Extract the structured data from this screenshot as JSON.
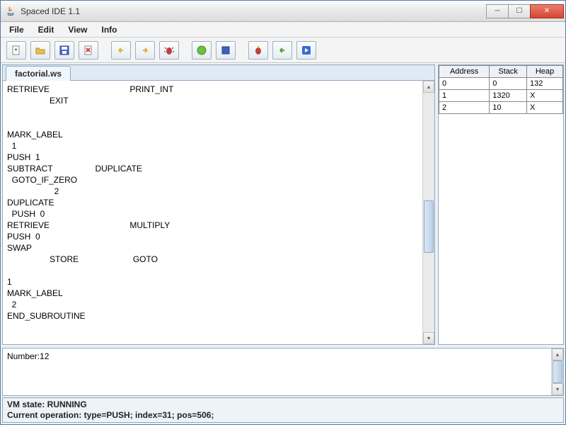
{
  "window": {
    "title": "Spaced IDE 1.1"
  },
  "menu": {
    "file": "File",
    "edit": "Edit",
    "view": "View",
    "info": "Info"
  },
  "toolbar_icons": {
    "new": "new-file-icon",
    "open": "open-folder-icon",
    "save": "save-icon",
    "close": "close-file-icon",
    "undo": "arrow-left-icon",
    "redo": "arrow-right-icon",
    "debug": "bug-icon",
    "run": "play-circle-icon",
    "stop": "stop-icon",
    "step": "bug-step-icon",
    "step2": "arrow-left-green-icon",
    "cont": "play-blue-icon"
  },
  "editor": {
    "tab": "factorial.ws",
    "content": "RETRIEVE                                  PRINT_INT\n                  EXIT\n\n\nMARK_LABEL\n  1\nPUSH  1\nSUBTRACT                  DUPLICATE\n  GOTO_IF_ZERO\n                    2\nDUPLICATE\n  PUSH  0\nRETRIEVE                                  MULTIPLY\nPUSH  0\nSWAP\n                  STORE                       GOTO\n\n1\nMARK_LABEL\n  2\nEND_SUBROUTINE"
  },
  "memory": {
    "headers": {
      "address": "Address",
      "stack": "Stack",
      "heap": "Heap"
    },
    "rows": [
      {
        "address": "0",
        "stack": "0",
        "heap": "132"
      },
      {
        "address": "1",
        "stack": "1320",
        "heap": "X"
      },
      {
        "address": "2",
        "stack": "10",
        "heap": "X"
      }
    ]
  },
  "console": {
    "output": "Number:12"
  },
  "status": {
    "line1": "VM state: RUNNING",
    "line2": "Current operation: type=PUSH; index=31; pos=506;"
  }
}
